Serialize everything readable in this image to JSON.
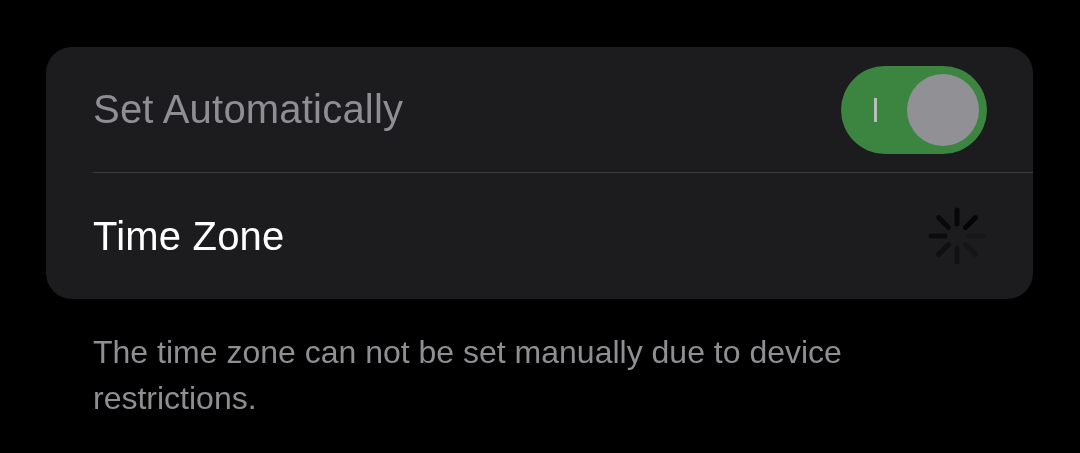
{
  "rows": [
    {
      "kind": "toggle",
      "label": "Set Automatically",
      "on": true,
      "disabled": true
    },
    {
      "kind": "spinner",
      "label": "Time Zone",
      "disabled": false
    }
  ],
  "footer": "The time zone can not be set manually due to device restrictions."
}
